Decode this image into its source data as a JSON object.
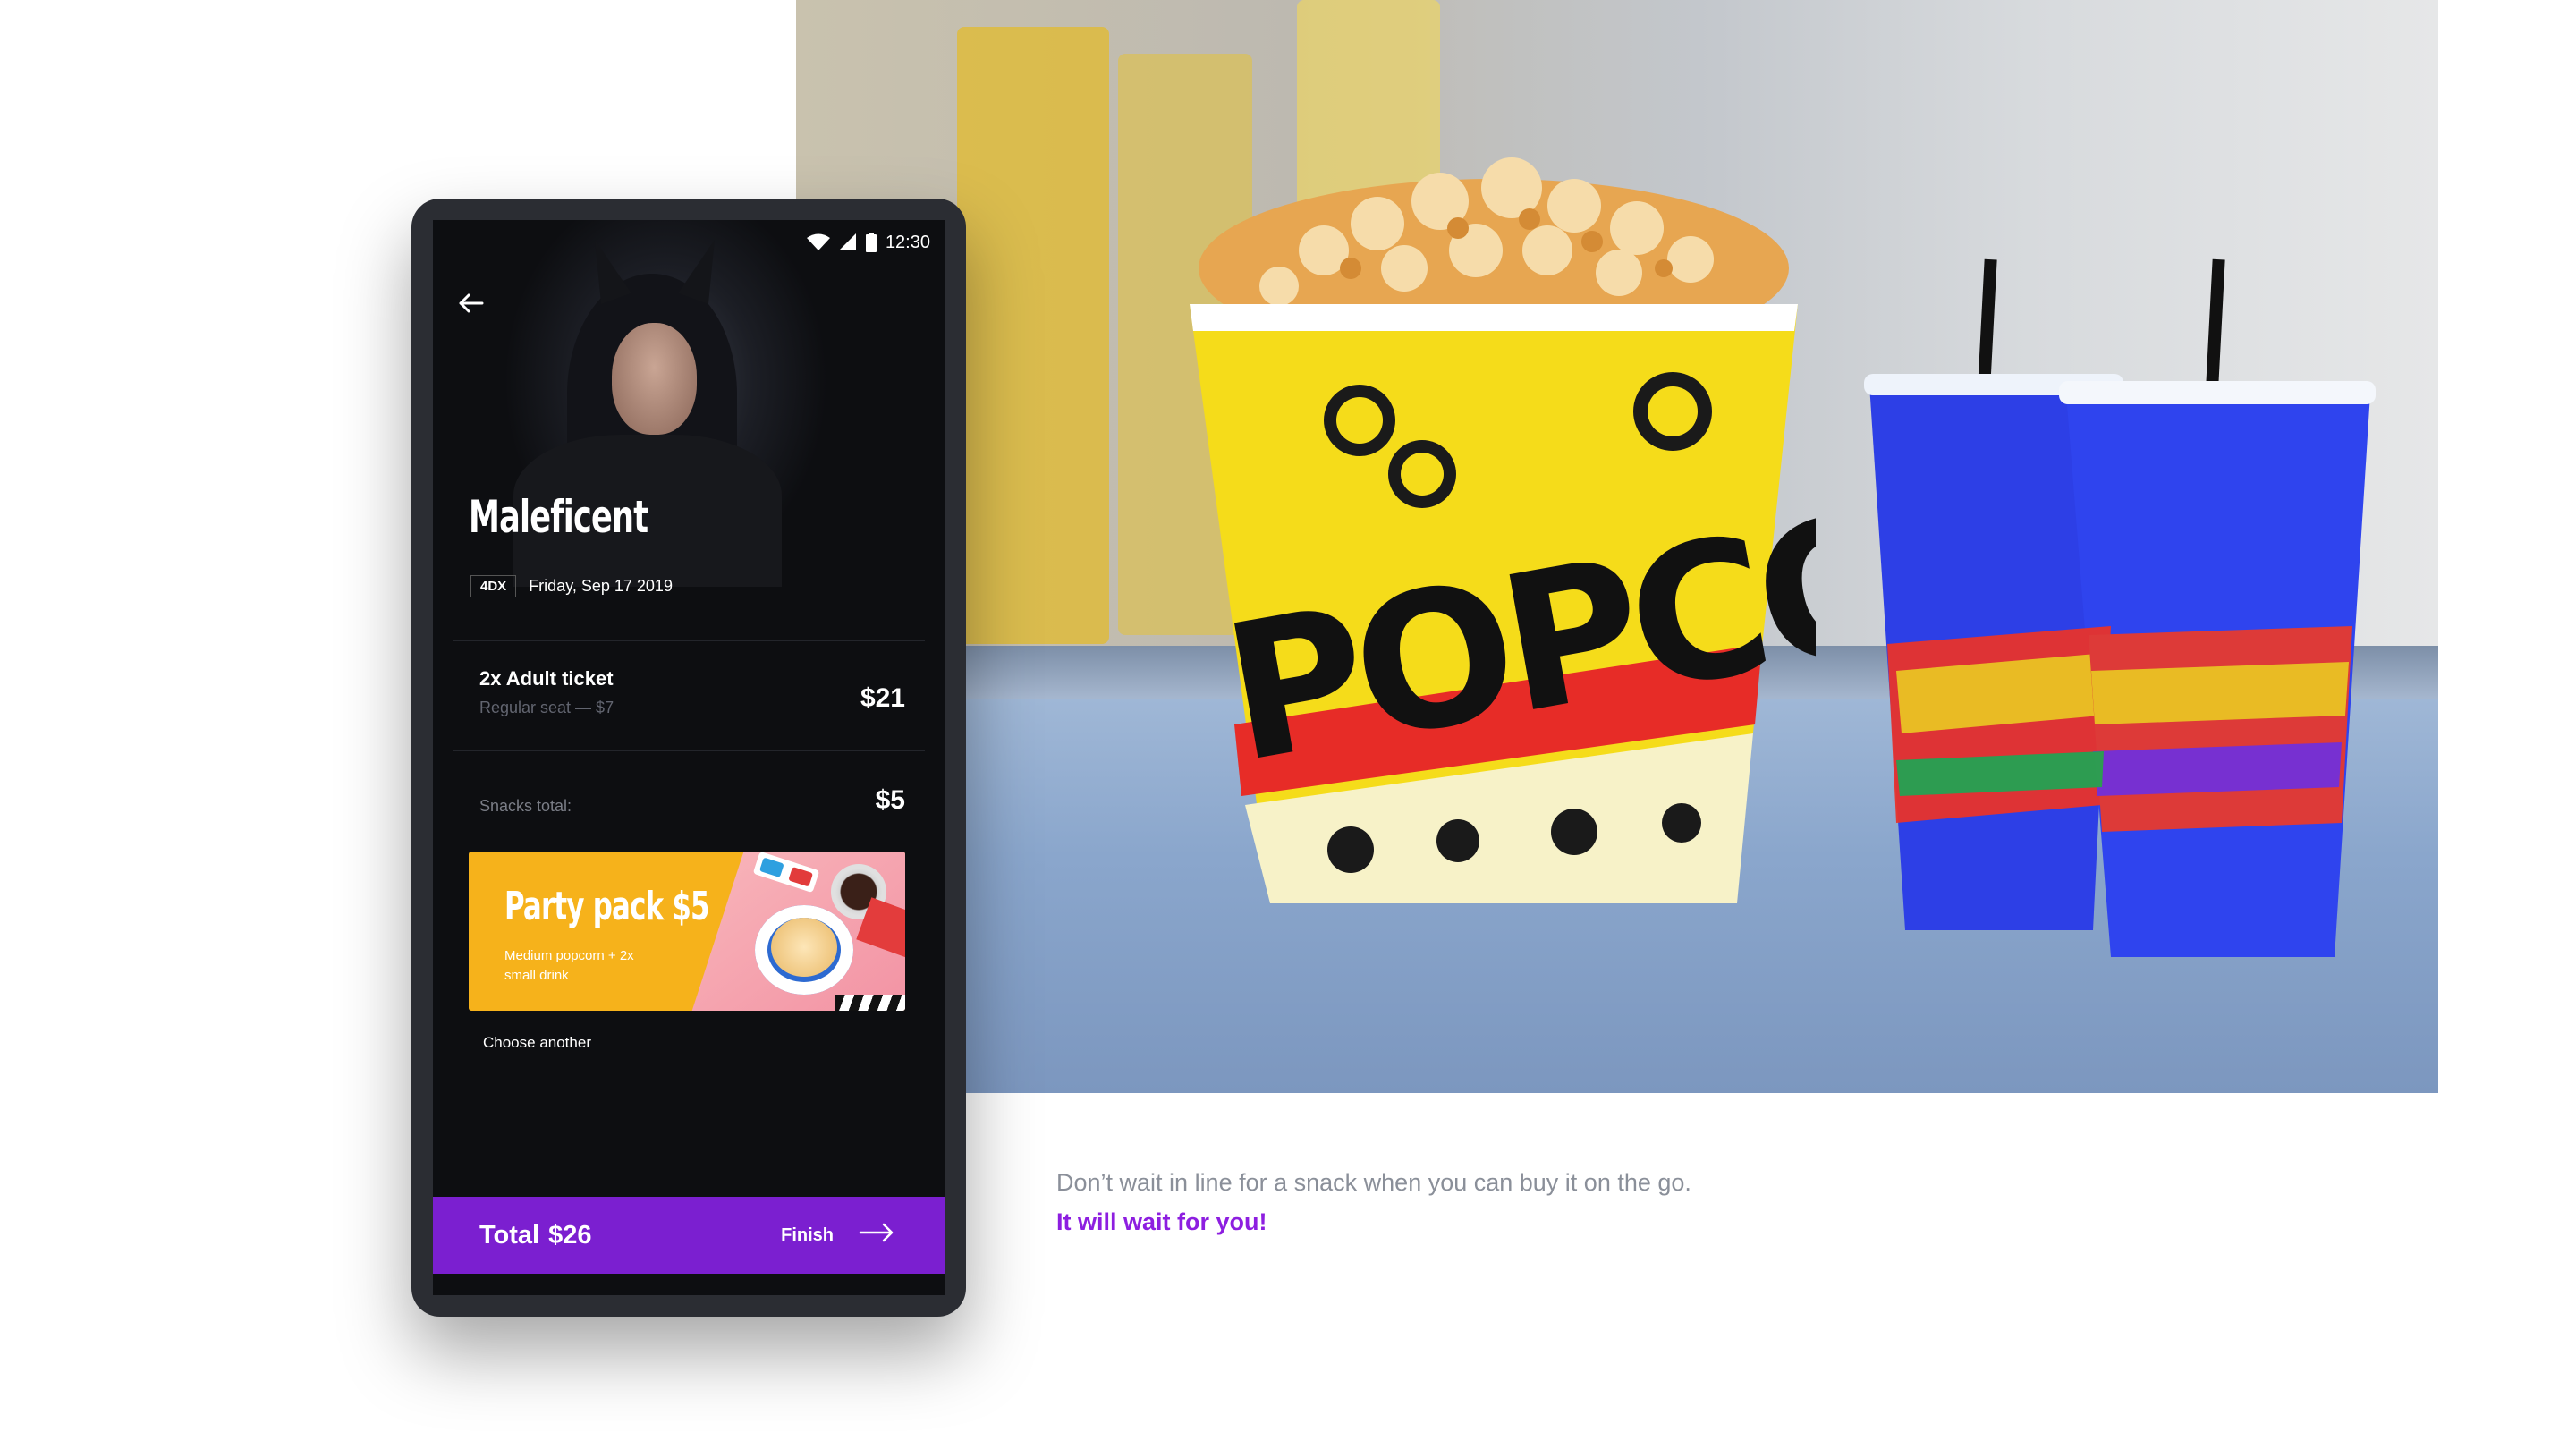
{
  "status_bar": {
    "time": "12:30"
  },
  "movie": {
    "title": "Maleficent",
    "format": "4DX",
    "date": "Friday, Sep 17 2019"
  },
  "ticket": {
    "title": "2x Adult ticket",
    "subtitle": "Regular seat  — $7",
    "price": "$21"
  },
  "snacks": {
    "label": "Snacks total:",
    "price": "$5"
  },
  "promo": {
    "title": "Party pack $5",
    "description": "Medium popcorn + 2x small drink",
    "choose_another": "Choose another"
  },
  "footer": {
    "total_label": "Total",
    "total_value": "$26",
    "finish_label": "Finish"
  },
  "caption": {
    "line1": "Don’t wait in line for a snack when you can buy it on the go.",
    "line2": "It will wait for you!"
  },
  "hero_photo": {
    "popcorn_bucket_text": "POPCORN"
  },
  "colors": {
    "accent_purple": "#7b1fd0",
    "promo_yellow": "#f6b21b",
    "screen_bg": "#0d0e11"
  }
}
